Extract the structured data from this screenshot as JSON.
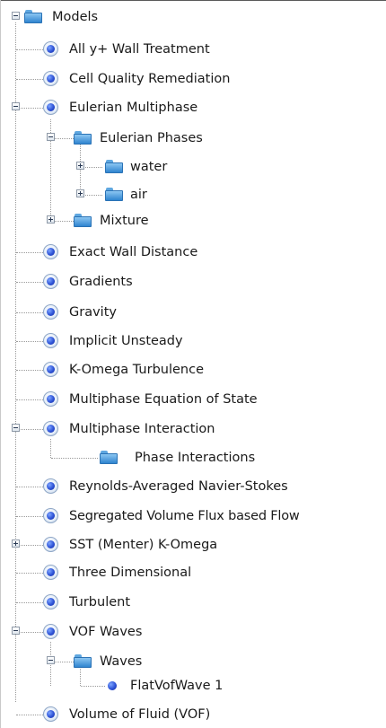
{
  "tree": {
    "root": {
      "label": "Models",
      "icon": "folder-icon",
      "expanded": true
    },
    "items": [
      {
        "id": "all-y-wall-treatment",
        "label": "All y+ Wall Treatment",
        "icon": "model-icon"
      },
      {
        "id": "cell-quality-remediation",
        "label": "Cell Quality Remediation",
        "icon": "model-icon"
      },
      {
        "id": "eulerian-multiphase",
        "label": "Eulerian Multiphase",
        "icon": "model-icon",
        "expanded": true
      },
      {
        "id": "eulerian-phases",
        "label": "Eulerian Phases",
        "icon": "folder-icon",
        "expanded": true
      },
      {
        "id": "water",
        "label": "water",
        "icon": "folder-icon",
        "expanded": false
      },
      {
        "id": "air",
        "label": "air",
        "icon": "folder-icon",
        "expanded": false
      },
      {
        "id": "mixture",
        "label": "Mixture",
        "icon": "folder-icon",
        "expanded": false
      },
      {
        "id": "exact-wall-distance",
        "label": "Exact Wall Distance",
        "icon": "model-icon"
      },
      {
        "id": "gradients",
        "label": "Gradients",
        "icon": "model-icon"
      },
      {
        "id": "gravity",
        "label": "Gravity",
        "icon": "model-icon"
      },
      {
        "id": "implicit-unsteady",
        "label": "Implicit Unsteady",
        "icon": "model-icon"
      },
      {
        "id": "k-omega-turbulence",
        "label": "K-Omega Turbulence",
        "icon": "model-icon"
      },
      {
        "id": "multiphase-equation-of-state",
        "label": "Multiphase Equation of State",
        "icon": "model-icon"
      },
      {
        "id": "multiphase-interaction",
        "label": "Multiphase Interaction",
        "icon": "model-icon",
        "expanded": true
      },
      {
        "id": "phase-interactions",
        "label": "Phase Interactions",
        "icon": "folder-icon"
      },
      {
        "id": "reynolds-averaged-navier-stokes",
        "label": "Reynolds-Averaged Navier-Stokes",
        "icon": "model-icon"
      },
      {
        "id": "segregated-volume-flux-based-flow",
        "label": "Segregated Volume Flux based Flow",
        "icon": "model-icon"
      },
      {
        "id": "sst-menter-k-omega",
        "label": "SST (Menter) K-Omega",
        "icon": "model-icon",
        "expanded": false
      },
      {
        "id": "three-dimensional",
        "label": "Three Dimensional",
        "icon": "model-icon"
      },
      {
        "id": "turbulent",
        "label": "Turbulent",
        "icon": "model-icon"
      },
      {
        "id": "vof-waves",
        "label": "VOF Waves",
        "icon": "model-icon",
        "expanded": true
      },
      {
        "id": "waves",
        "label": "Waves",
        "icon": "folder-icon",
        "expanded": true
      },
      {
        "id": "flatvofwave-1",
        "label": "FlatVofWave 1",
        "icon": "object-icon"
      },
      {
        "id": "volume-of-fluid-vof",
        "label": "Volume of Fluid (VOF)",
        "icon": "model-icon"
      }
    ]
  }
}
